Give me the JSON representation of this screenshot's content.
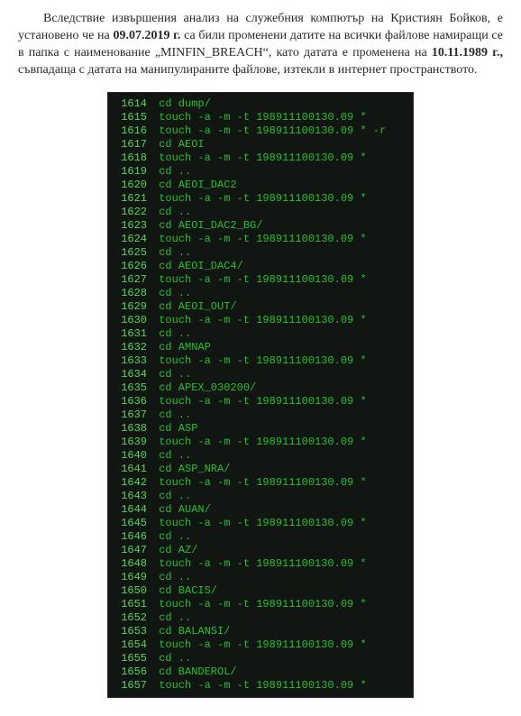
{
  "paragraph": {
    "t1": "Вследствие извършения анализ на служебния компютър на Кристиян Бойков, е установено че на ",
    "date1": "09.07.2019 г.",
    "t2": " са били променени датите на всички файлове намиращи се в папка с наименование „MINFIN_BREACH“, като датата е променена на ",
    "date2": "10.11.1989 г.,",
    "t3": " съвпадаща с датата на манипулираните файлове, изтекли в интернет пространството."
  },
  "terminal": {
    "lines": [
      {
        "n": "1614",
        "c": "cd dump/"
      },
      {
        "n": "1615",
        "c": "touch -a -m -t 198911100130.09 *"
      },
      {
        "n": "1616",
        "c": "touch -a -m -t 198911100130.09 * -r"
      },
      {
        "n": "1617",
        "c": "cd AEOI"
      },
      {
        "n": "1618",
        "c": "touch -a -m -t 198911100130.09 *"
      },
      {
        "n": "1619",
        "c": "cd .."
      },
      {
        "n": "1620",
        "c": "cd AEOI_DAC2"
      },
      {
        "n": "1621",
        "c": "touch -a -m -t 198911100130.09 *"
      },
      {
        "n": "1622",
        "c": "cd .."
      },
      {
        "n": "1623",
        "c": "cd AEOI_DAC2_BG/"
      },
      {
        "n": "1624",
        "c": "touch -a -m -t 198911100130.09 *"
      },
      {
        "n": "1625",
        "c": "cd .."
      },
      {
        "n": "1626",
        "c": "cd AEOI_DAC4/"
      },
      {
        "n": "1627",
        "c": "touch -a -m -t 198911100130.09 *"
      },
      {
        "n": "1628",
        "c": "cd .."
      },
      {
        "n": "1629",
        "c": "cd AEOI_OUT/"
      },
      {
        "n": "1630",
        "c": "touch -a -m -t 198911100130.09 *"
      },
      {
        "n": "1631",
        "c": "cd .."
      },
      {
        "n": "1632",
        "c": "cd AMNAP"
      },
      {
        "n": "1633",
        "c": "touch -a -m -t 198911100130.09 *"
      },
      {
        "n": "1634",
        "c": "cd .."
      },
      {
        "n": "1635",
        "c": "cd APEX_030200/"
      },
      {
        "n": "1636",
        "c": "touch -a -m -t 198911100130.09 *"
      },
      {
        "n": "1637",
        "c": "cd .."
      },
      {
        "n": "1638",
        "c": "cd ASP"
      },
      {
        "n": "1639",
        "c": "touch -a -m -t 198911100130.09 *"
      },
      {
        "n": "1640",
        "c": "cd .."
      },
      {
        "n": "1641",
        "c": "cd ASP_NRA/"
      },
      {
        "n": "1642",
        "c": "touch -a -m -t 198911100130.09 *"
      },
      {
        "n": "1643",
        "c": "cd .."
      },
      {
        "n": "1644",
        "c": "cd AUAN/"
      },
      {
        "n": "1645",
        "c": "touch -a -m -t 198911100130.09 *"
      },
      {
        "n": "1646",
        "c": "cd .."
      },
      {
        "n": "1647",
        "c": "cd AZ/"
      },
      {
        "n": "1648",
        "c": "touch -a -m -t 198911100130.09 *"
      },
      {
        "n": "1649",
        "c": "cd .."
      },
      {
        "n": "1650",
        "c": "cd BACIS/"
      },
      {
        "n": "1651",
        "c": "touch -a -m -t 198911100130.09 *"
      },
      {
        "n": "1652",
        "c": "cd .."
      },
      {
        "n": "1653",
        "c": "cd BALANSI/"
      },
      {
        "n": "1654",
        "c": "touch -a -m -t 198911100130.09 *"
      },
      {
        "n": "1655",
        "c": "cd .."
      },
      {
        "n": "1656",
        "c": "cd BANDEROL/"
      },
      {
        "n": "1657",
        "c": "touch -a -m -t 198911100130.09 *"
      }
    ]
  }
}
